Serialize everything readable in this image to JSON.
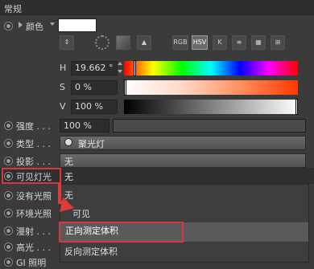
{
  "header": {
    "title": "常规"
  },
  "color_row": {
    "label": "颜色"
  },
  "mode_buttons": [
    "RGB",
    "HSV",
    "K"
  ],
  "sliders": {
    "h": {
      "label": "H",
      "value": "19.662 °",
      "position": 0.055
    },
    "s": {
      "label": "S",
      "value": "0 %",
      "position": 0.0
    },
    "v": {
      "label": "V",
      "value": "100 %",
      "position": 1.0
    }
  },
  "properties": {
    "intensity": {
      "label": "强度 . . .",
      "value": "100 %"
    },
    "type": {
      "label": "类型 . . .",
      "value": "聚光灯"
    },
    "shadow": {
      "label": "投影 . . .",
      "value": "无"
    },
    "visible_light": {
      "label": "可见灯光",
      "value": "无"
    },
    "no_light": {
      "label": "没有光照"
    },
    "ambient": {
      "label": "环境光照"
    },
    "diffuse": {
      "label": "漫射 . . ."
    },
    "specular": {
      "label": "高光 . . ."
    },
    "gi": {
      "label": "GI 照明"
    }
  },
  "dropdown": {
    "items": [
      "无",
      "可见",
      "正向测定体积",
      "反向测定体积"
    ],
    "highlighted_index": 2
  },
  "colors": {
    "highlight_box": "#d9363e",
    "arrow": "#e03a3a"
  }
}
